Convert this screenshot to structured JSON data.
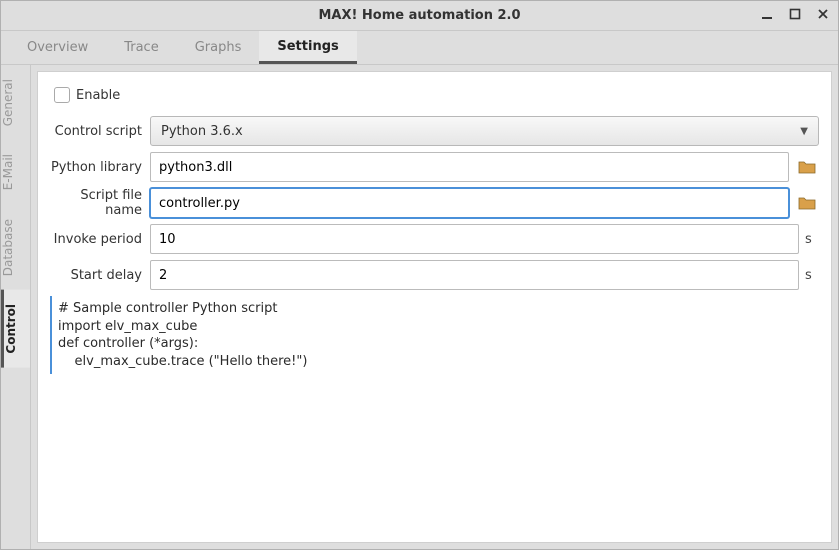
{
  "window": {
    "title": "MAX! Home automation 2.0"
  },
  "topTabs": [
    {
      "label": "Overview"
    },
    {
      "label": "Trace"
    },
    {
      "label": "Graphs"
    },
    {
      "label": "Settings"
    }
  ],
  "sideTabs": [
    {
      "label": "General"
    },
    {
      "label": "E-Mail"
    },
    {
      "label": "Database"
    },
    {
      "label": "Control"
    }
  ],
  "form": {
    "enableLabel": "Enable",
    "controlScriptLabel": "Control script",
    "controlScriptValue": "Python 3.6.x",
    "pythonLibLabel": "Python library",
    "pythonLibValue": "python3.dll",
    "scriptFileLabel": "Script file name",
    "scriptFileValue": "controller.py",
    "invokePeriodLabel": "Invoke period",
    "invokePeriodValue": "10",
    "invokePeriodUnit": "s",
    "startDelayLabel": "Start delay",
    "startDelayValue": "2",
    "startDelayUnit": "s"
  },
  "sample": "# Sample controller Python script\nimport elv_max_cube\ndef controller (*args):\n    elv_max_cube.trace (\"Hello there!\")"
}
